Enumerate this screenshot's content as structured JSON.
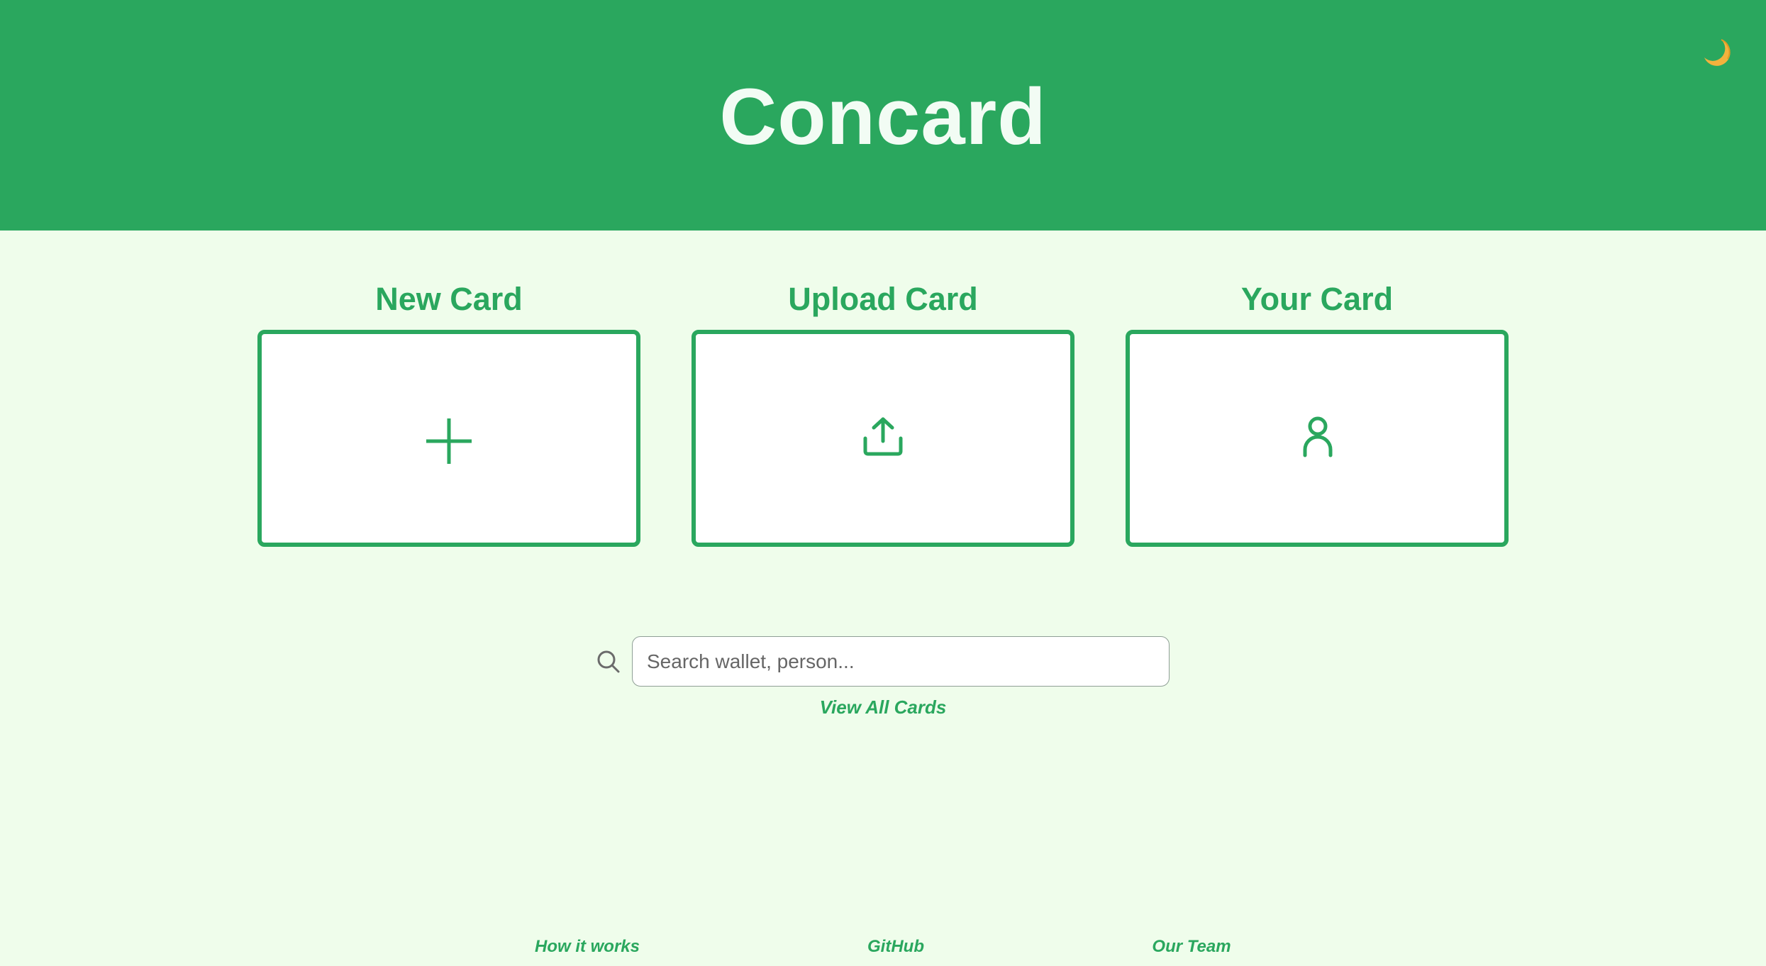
{
  "header": {
    "title": "Concard",
    "theme_toggle_icon": "crescent-moon-icon"
  },
  "actions": [
    {
      "label": "New Card",
      "icon": "plus-icon"
    },
    {
      "label": "Upload Card",
      "icon": "upload-icon"
    },
    {
      "label": "Your Card",
      "icon": "user-icon"
    }
  ],
  "search": {
    "icon": "search-icon",
    "placeholder": "Search wallet, person...",
    "value": ""
  },
  "view_all_label": "View All Cards",
  "footer": {
    "links": [
      {
        "label": "How it works"
      },
      {
        "label": "GitHub"
      },
      {
        "label": "Our Team"
      }
    ]
  },
  "colors": {
    "brand_green": "#2aa75e",
    "page_background": "#effdeb",
    "title_text": "#f2fcf4",
    "moon": "#f4b23d"
  }
}
